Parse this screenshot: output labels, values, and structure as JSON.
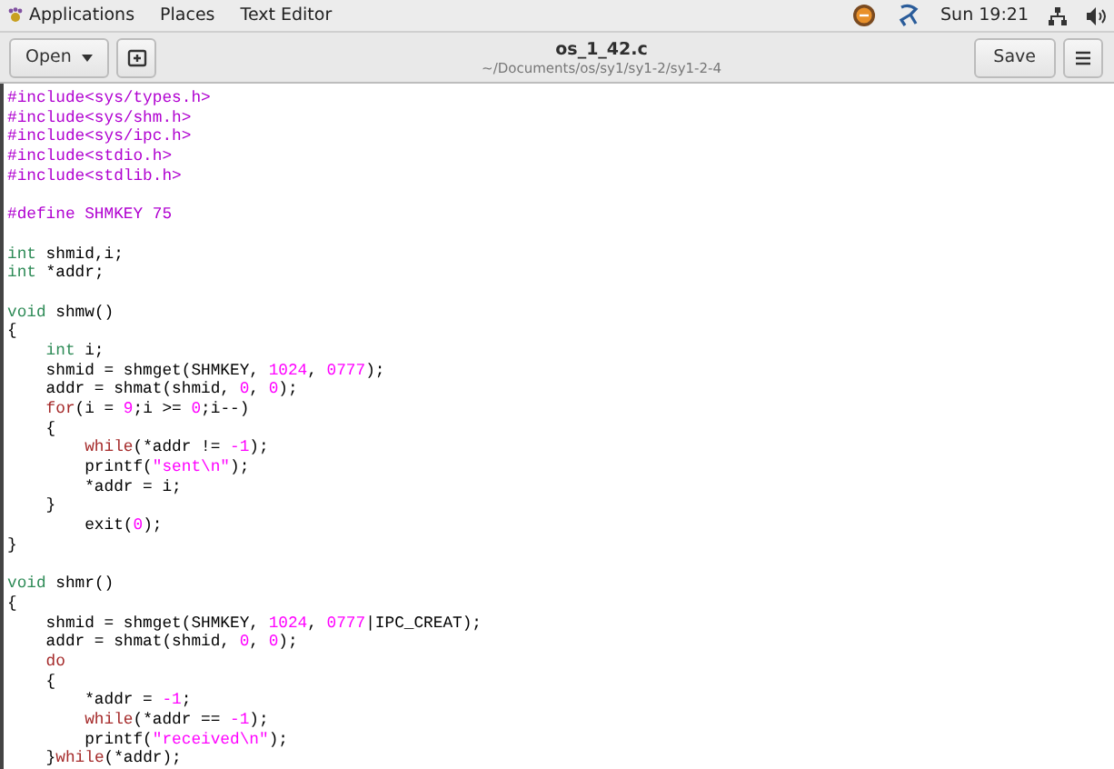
{
  "top_bar": {
    "menus": [
      "Applications",
      "Places",
      "Text Editor"
    ],
    "clock": "Sun 19:21"
  },
  "header_bar": {
    "open_button": "Open",
    "title": "os_1_42.c",
    "subtitle": "~/Documents/os/sy1/sy1-2/sy1-2-4",
    "save_button": "Save"
  },
  "editor": {
    "lines": [
      {
        "kind": "code",
        "tokens": [
          {
            "kind": "preproc",
            "text": "#include<sys/types.h>"
          }
        ]
      },
      {
        "kind": "code",
        "tokens": [
          {
            "kind": "preproc",
            "text": "#include<sys/shm.h>"
          }
        ]
      },
      {
        "kind": "code",
        "tokens": [
          {
            "kind": "preproc",
            "text": "#include<sys/ipc.h>"
          }
        ]
      },
      {
        "kind": "code",
        "tokens": [
          {
            "kind": "preproc",
            "text": "#include<stdio.h>"
          }
        ]
      },
      {
        "kind": "code",
        "tokens": [
          {
            "kind": "preproc",
            "text": "#include<stdlib.h>"
          }
        ]
      },
      {
        "kind": "blank"
      },
      {
        "kind": "code",
        "tokens": [
          {
            "kind": "preproc",
            "text": "#define SHMKEY 75"
          }
        ]
      },
      {
        "kind": "blank"
      },
      {
        "kind": "code",
        "tokens": [
          {
            "kind": "type",
            "text": "int"
          },
          {
            "kind": "plain",
            "text": " shmid,i;"
          }
        ]
      },
      {
        "kind": "code",
        "tokens": [
          {
            "kind": "type",
            "text": "int"
          },
          {
            "kind": "plain",
            "text": " *addr;"
          }
        ]
      },
      {
        "kind": "blank"
      },
      {
        "kind": "code",
        "tokens": [
          {
            "kind": "type",
            "text": "void"
          },
          {
            "kind": "plain",
            "text": " shmw()"
          }
        ]
      },
      {
        "kind": "code",
        "tokens": [
          {
            "kind": "plain",
            "text": "{"
          }
        ]
      },
      {
        "kind": "code",
        "tokens": [
          {
            "kind": "type",
            "text": "    int"
          },
          {
            "kind": "plain",
            "text": " i;"
          }
        ]
      },
      {
        "kind": "code",
        "tokens": [
          {
            "kind": "plain",
            "text": "    shmid = shmget(SHMKEY, "
          },
          {
            "kind": "number",
            "text": "1024"
          },
          {
            "kind": "plain",
            "text": ", "
          },
          {
            "kind": "number",
            "text": "0777"
          },
          {
            "kind": "plain",
            "text": ");"
          }
        ]
      },
      {
        "kind": "code",
        "tokens": [
          {
            "kind": "plain",
            "text": "    addr = shmat(shmid, "
          },
          {
            "kind": "number",
            "text": "0"
          },
          {
            "kind": "plain",
            "text": ", "
          },
          {
            "kind": "number",
            "text": "0"
          },
          {
            "kind": "plain",
            "text": ");"
          }
        ]
      },
      {
        "kind": "code",
        "tokens": [
          {
            "kind": "keyword",
            "text": "    for"
          },
          {
            "kind": "plain",
            "text": "(i = "
          },
          {
            "kind": "number",
            "text": "9"
          },
          {
            "kind": "plain",
            "text": ";i >= "
          },
          {
            "kind": "number",
            "text": "0"
          },
          {
            "kind": "plain",
            "text": ";i--)"
          }
        ]
      },
      {
        "kind": "code",
        "tokens": [
          {
            "kind": "plain",
            "text": "    {"
          }
        ]
      },
      {
        "kind": "code",
        "tokens": [
          {
            "kind": "keyword",
            "text": "        while"
          },
          {
            "kind": "plain",
            "text": "(*addr != "
          },
          {
            "kind": "number",
            "text": "-1"
          },
          {
            "kind": "plain",
            "text": ");"
          }
        ]
      },
      {
        "kind": "code",
        "tokens": [
          {
            "kind": "plain",
            "text": "        printf("
          },
          {
            "kind": "string",
            "text": "\"sent\\n\""
          },
          {
            "kind": "plain",
            "text": ");"
          }
        ]
      },
      {
        "kind": "code",
        "tokens": [
          {
            "kind": "plain",
            "text": "        *addr = i;"
          }
        ]
      },
      {
        "kind": "code",
        "tokens": [
          {
            "kind": "plain",
            "text": "    }"
          }
        ]
      },
      {
        "kind": "code",
        "tokens": [
          {
            "kind": "plain",
            "text": "        exit("
          },
          {
            "kind": "number",
            "text": "0"
          },
          {
            "kind": "plain",
            "text": ");"
          }
        ]
      },
      {
        "kind": "code",
        "tokens": [
          {
            "kind": "plain",
            "text": "}"
          }
        ]
      },
      {
        "kind": "blank"
      },
      {
        "kind": "code",
        "tokens": [
          {
            "kind": "type",
            "text": "void"
          },
          {
            "kind": "plain",
            "text": " shmr()"
          }
        ]
      },
      {
        "kind": "code",
        "tokens": [
          {
            "kind": "plain",
            "text": "{"
          }
        ]
      },
      {
        "kind": "code",
        "tokens": [
          {
            "kind": "plain",
            "text": "    shmid = shmget(SHMKEY, "
          },
          {
            "kind": "number",
            "text": "1024"
          },
          {
            "kind": "plain",
            "text": ", "
          },
          {
            "kind": "number",
            "text": "0777"
          },
          {
            "kind": "plain",
            "text": "|IPC_CREAT);"
          }
        ]
      },
      {
        "kind": "code",
        "tokens": [
          {
            "kind": "plain",
            "text": "    addr = shmat(shmid, "
          },
          {
            "kind": "number",
            "text": "0"
          },
          {
            "kind": "plain",
            "text": ", "
          },
          {
            "kind": "number",
            "text": "0"
          },
          {
            "kind": "plain",
            "text": ");"
          }
        ]
      },
      {
        "kind": "code",
        "tokens": [
          {
            "kind": "keyword",
            "text": "    do"
          }
        ]
      },
      {
        "kind": "code",
        "tokens": [
          {
            "kind": "plain",
            "text": "    {"
          }
        ]
      },
      {
        "kind": "code",
        "tokens": [
          {
            "kind": "plain",
            "text": "        *addr = "
          },
          {
            "kind": "number",
            "text": "-1"
          },
          {
            "kind": "plain",
            "text": ";"
          }
        ]
      },
      {
        "kind": "code",
        "tokens": [
          {
            "kind": "keyword",
            "text": "        while"
          },
          {
            "kind": "plain",
            "text": "(*addr == "
          },
          {
            "kind": "number",
            "text": "-1"
          },
          {
            "kind": "plain",
            "text": ");"
          }
        ]
      },
      {
        "kind": "code",
        "tokens": [
          {
            "kind": "plain",
            "text": "        printf("
          },
          {
            "kind": "string",
            "text": "\"received\\n\""
          },
          {
            "kind": "plain",
            "text": ");"
          }
        ]
      },
      {
        "kind": "code",
        "tokens": [
          {
            "kind": "plain",
            "text": "    }"
          },
          {
            "kind": "keyword",
            "text": "while"
          },
          {
            "kind": "plain",
            "text": "(*addr);"
          }
        ]
      }
    ]
  }
}
